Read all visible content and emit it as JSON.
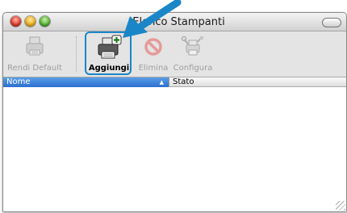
{
  "window": {
    "title": "Elenco Stampanti"
  },
  "toolbar": {
    "items": [
      {
        "label": "Rendi Default",
        "icon": "printer-default-icon",
        "enabled": false
      },
      {
        "label": "Aggiungi",
        "icon": "printer-add-icon",
        "enabled": true,
        "highlighted": true
      },
      {
        "label": "Elimina",
        "icon": "delete-icon",
        "enabled": false
      },
      {
        "label": "Configura",
        "icon": "configure-icon",
        "enabled": false
      }
    ]
  },
  "table": {
    "columns": [
      {
        "label": "Nome",
        "sorted": true
      },
      {
        "label": "Stato"
      }
    ],
    "rows": []
  },
  "colors": {
    "highlight": "#1a86c8",
    "header_selected": "#2a6fd0"
  }
}
